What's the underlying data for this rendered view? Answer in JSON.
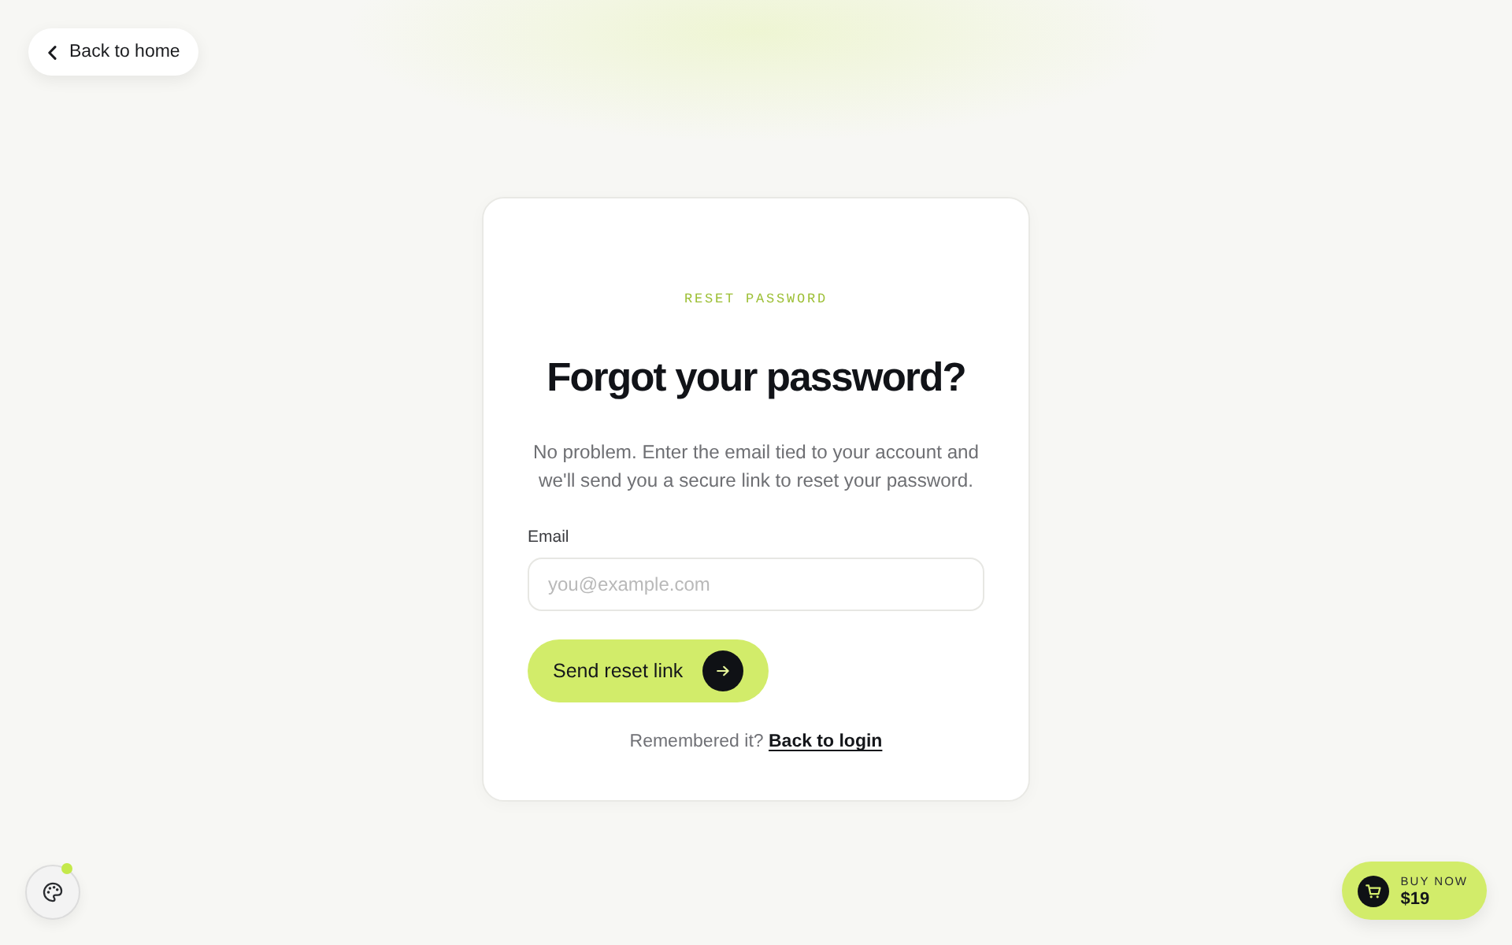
{
  "back_link": {
    "label": "Back to home"
  },
  "card": {
    "eyebrow": "RESET PASSWORD",
    "title": "Forgot your password?",
    "description": "No problem. Enter the email tied to your account and we'll send you a secure link to reset your password.",
    "email_field": {
      "label": "Email",
      "placeholder": "you@example.com"
    },
    "submit_button": {
      "label": "Send reset link"
    },
    "footer": {
      "text": "Remembered it?",
      "link": "Back to login"
    }
  },
  "theme_button": {
    "indicator": true
  },
  "buy_button": {
    "label": "BUY NOW",
    "price": "$19"
  }
}
